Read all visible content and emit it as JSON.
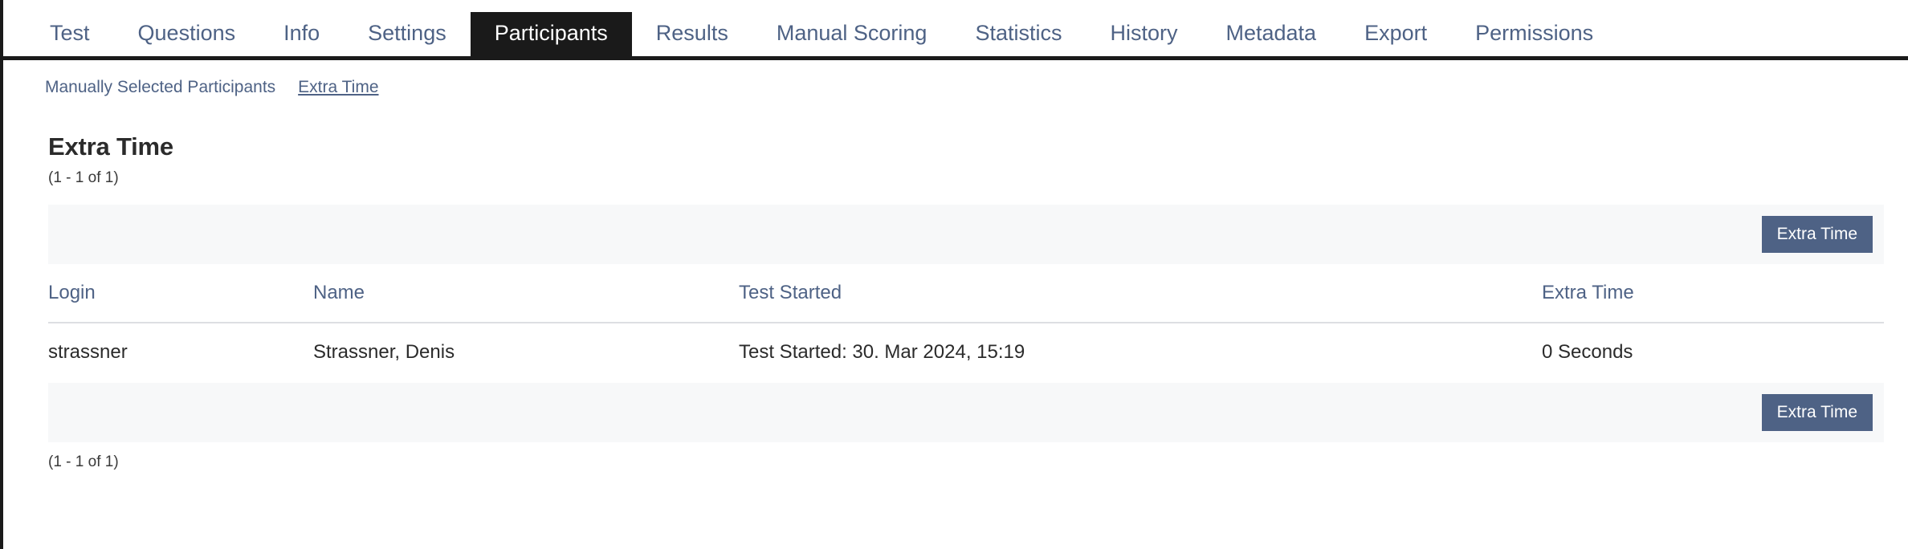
{
  "tabs": [
    {
      "label": "Test",
      "active": false
    },
    {
      "label": "Questions",
      "active": false
    },
    {
      "label": "Info",
      "active": false
    },
    {
      "label": "Settings",
      "active": false
    },
    {
      "label": "Participants",
      "active": true
    },
    {
      "label": "Results",
      "active": false
    },
    {
      "label": "Manual Scoring",
      "active": false
    },
    {
      "label": "Statistics",
      "active": false
    },
    {
      "label": "History",
      "active": false
    },
    {
      "label": "Metadata",
      "active": false
    },
    {
      "label": "Export",
      "active": false
    },
    {
      "label": "Permissions",
      "active": false
    }
  ],
  "subnav": [
    {
      "label": "Manually Selected Participants",
      "active": false
    },
    {
      "label": "Extra Time",
      "active": true
    }
  ],
  "main": {
    "title": "Extra Time",
    "count_top": "(1 - 1 of 1)",
    "count_bottom": "(1 - 1 of 1)"
  },
  "toolbar_top": {
    "button_label": "Extra Time"
  },
  "toolbar_bottom": {
    "button_label": "Extra Time"
  },
  "table": {
    "headers": {
      "login": "Login",
      "name": "Name",
      "test_started": "Test Started",
      "extra_time": "Extra Time"
    },
    "rows": [
      {
        "login": "strassner",
        "name": "Strassner, Denis",
        "test_started": "Test Started: 30. Mar 2024, 15:19",
        "extra_time": "0 Seconds"
      }
    ]
  },
  "colors": {
    "link": "#4e6285",
    "active_tab_bg": "#1a1a1a",
    "button_bg": "#4e6285",
    "toolbar_bg": "#f7f8f9",
    "text": "#2b2b2b"
  }
}
